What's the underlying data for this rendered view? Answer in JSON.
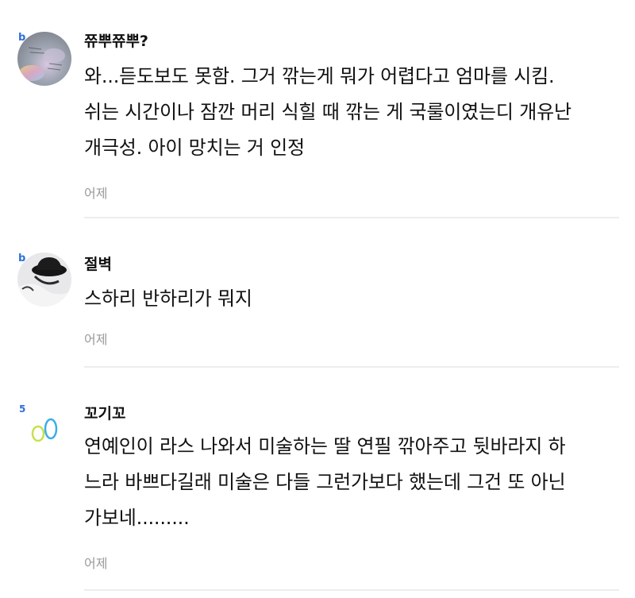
{
  "comments": [
    {
      "nickname": "쮸뿌쮸뿌?",
      "lines": [
        "와...듣도보도 못함. 그거 깎는게 뭐가 어렵다고 엄마를 시킴.",
        "쉬는 시간이나 잠깐 머리 식힐 때 깎는 게 국룰이였는디 개유난",
        "개극성. 아이 망치는 거 인정"
      ],
      "time": "어제",
      "level": "b"
    },
    {
      "nickname": "절벽",
      "lines": [
        "스하리 반하리가 뭐지"
      ],
      "time": "어제",
      "level": "b"
    },
    {
      "nickname": "꼬기꼬",
      "lines": [
        "연예인이 라스 나와서 미술하는 딸 연필 깎아주고 뒷바라지 하",
        "느라 바쁘다길래 미술은 다들 그런가보다 했는데 그건 또 아닌",
        "가보네........."
      ],
      "time": "어제",
      "level": "5"
    }
  ]
}
